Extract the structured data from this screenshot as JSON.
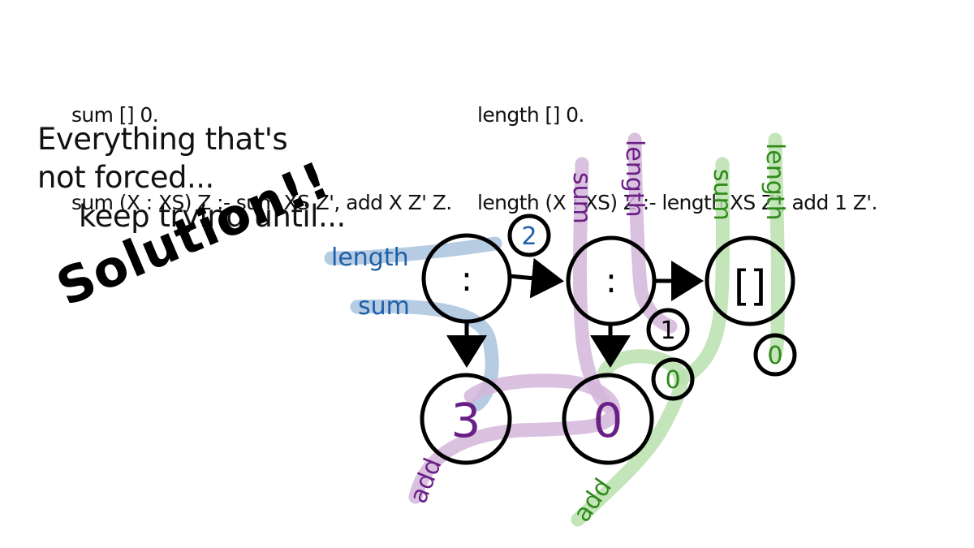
{
  "code": {
    "sum": [
      "sum [] 0.",
      "sum (X : XS) Z :- sum XS Z', add X Z' Z."
    ],
    "length": [
      "length [] 0.",
      "length (X : XS) Z :- length XS Z', add 1 Z'."
    ]
  },
  "caption": {
    "line1": "Everything that's",
    "line2": "not forced...",
    "line3": "keep trying until...",
    "exclaim": "Solution!!"
  },
  "nodes": {
    "cons1": ":",
    "cons2": ":",
    "nil": "[]",
    "three": "3",
    "zero": "0",
    "small_two": "2",
    "small_one": "1",
    "small_zero_a": "0",
    "small_zero_b": "0"
  },
  "strand_labels": {
    "length_blue": "length",
    "sum_blue": "sum",
    "sum_purple": "sum",
    "length_purple": "length",
    "sum_green": "sum",
    "length_green": "length",
    "add_purple": "add",
    "add_green": "add"
  },
  "colors": {
    "blue": "#1e5fa8",
    "blue_strand": "#a9c3de",
    "purple": "#6a1f86",
    "purple_strand": "#d3b6db",
    "green": "#2f8a1a",
    "green_strand": "#b8e0ad",
    "ink": "#000000"
  }
}
